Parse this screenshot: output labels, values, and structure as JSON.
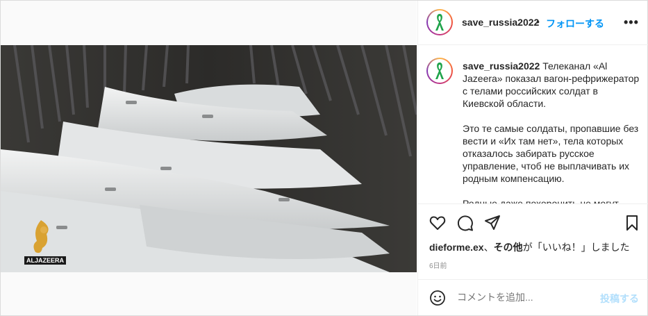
{
  "account": {
    "username": "save_russia2022",
    "follow_label": "フォローする",
    "separator": "•"
  },
  "caption": {
    "username": "save_russia2022",
    "text": "Телеканал «Al Jazeera» показал вагон-рефрижератор с телами российских солдат в Киевской области.\n\nЭто те самые солдаты, пропавшие без вести и «Их там нет», тела которых отказалось забирать русское управление, чтоб не выплачивать их родным компенсацию.\n\nРодные даже похоронить не могут"
  },
  "video": {
    "watermark": "ALJAZEERA"
  },
  "likes": {
    "user": "dieforme.ex",
    "separator": "、",
    "others": "その他",
    "suffix": "が「いいね！」しました"
  },
  "timestamp": "6日前",
  "comment": {
    "placeholder": "コメントを追加...",
    "post_label": "投稿する"
  },
  "icons": [
    "heart-icon",
    "comment-icon",
    "share-icon",
    "bookmark-icon",
    "emoji-icon",
    "more-icon"
  ],
  "colors": {
    "link": "#0095f6",
    "post_disabled": "#b2dffc",
    "ribbon": "#1fa34a"
  }
}
